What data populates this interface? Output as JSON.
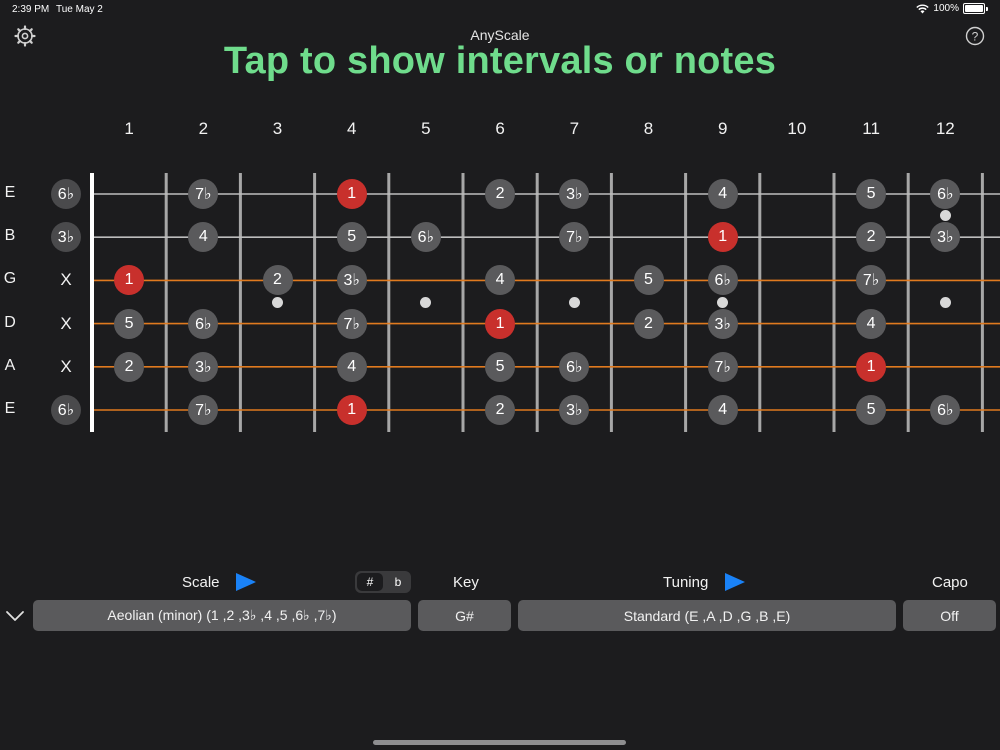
{
  "status": {
    "time": "2:39 PM",
    "date": "Tue May 2",
    "battery": "100%"
  },
  "app": {
    "title": "AnyScale",
    "headline": "Tap to show intervals or notes"
  },
  "icons": {
    "settings": "gear-icon",
    "help": "question-mark-icon",
    "collapse": "chevron-down-icon",
    "play": "play-icon"
  },
  "fret_numbers": [
    "1",
    "2",
    "3",
    "4",
    "5",
    "6",
    "7",
    "8",
    "9",
    "10",
    "11",
    "12"
  ],
  "strings": [
    {
      "name": "E",
      "open": "6♭",
      "notes": [
        {
          "fret": 2,
          "label": "7♭"
        },
        {
          "fret": 4,
          "label": "1",
          "root": true
        },
        {
          "fret": 6,
          "label": "2"
        },
        {
          "fret": 7,
          "label": "3♭"
        },
        {
          "fret": 9,
          "label": "4"
        },
        {
          "fret": 11,
          "label": "5"
        },
        {
          "fret": 12,
          "label": "6♭"
        }
      ]
    },
    {
      "name": "B",
      "open": "3♭",
      "notes": [
        {
          "fret": 2,
          "label": "4"
        },
        {
          "fret": 4,
          "label": "5"
        },
        {
          "fret": 5,
          "label": "6♭"
        },
        {
          "fret": 7,
          "label": "7♭"
        },
        {
          "fret": 9,
          "label": "1",
          "root": true
        },
        {
          "fret": 11,
          "label": "2"
        },
        {
          "fret": 12,
          "label": "3♭"
        }
      ]
    },
    {
      "name": "G",
      "open": "X",
      "notes": [
        {
          "fret": 1,
          "label": "1",
          "root": true
        },
        {
          "fret": 3,
          "label": "2"
        },
        {
          "fret": 4,
          "label": "3♭"
        },
        {
          "fret": 6,
          "label": "4"
        },
        {
          "fret": 8,
          "label": "5"
        },
        {
          "fret": 9,
          "label": "6♭"
        },
        {
          "fret": 11,
          "label": "7♭"
        }
      ]
    },
    {
      "name": "D",
      "open": "X",
      "notes": [
        {
          "fret": 1,
          "label": "5"
        },
        {
          "fret": 2,
          "label": "6♭"
        },
        {
          "fret": 4,
          "label": "7♭"
        },
        {
          "fret": 6,
          "label": "1",
          "root": true
        },
        {
          "fret": 8,
          "label": "2"
        },
        {
          "fret": 9,
          "label": "3♭"
        },
        {
          "fret": 11,
          "label": "4"
        }
      ]
    },
    {
      "name": "A",
      "open": "X",
      "notes": [
        {
          "fret": 1,
          "label": "2"
        },
        {
          "fret": 2,
          "label": "3♭"
        },
        {
          "fret": 4,
          "label": "4"
        },
        {
          "fret": 6,
          "label": "5"
        },
        {
          "fret": 7,
          "label": "6♭"
        },
        {
          "fret": 9,
          "label": "7♭"
        },
        {
          "fret": 11,
          "label": "1",
          "root": true
        }
      ]
    },
    {
      "name": "E",
      "open": "6♭",
      "notes": [
        {
          "fret": 2,
          "label": "7♭"
        },
        {
          "fret": 4,
          "label": "1",
          "root": true
        },
        {
          "fret": 6,
          "label": "2"
        },
        {
          "fret": 7,
          "label": "3♭"
        },
        {
          "fret": 9,
          "label": "4"
        },
        {
          "fret": 11,
          "label": "5"
        },
        {
          "fret": 12,
          "label": "6♭"
        }
      ]
    }
  ],
  "inlays": [
    3,
    5,
    7,
    9,
    12
  ],
  "colors": {
    "headline": "#6fdc8c",
    "root": "#c8302c",
    "note": "#5a5a5c",
    "wound_string": "#e07a1f",
    "plain_string": "#bdbdbd",
    "accent": "#1a82f7"
  },
  "controls": {
    "scale_label": "Scale",
    "sharp": "#",
    "flat": "b",
    "key_label": "Key",
    "tuning_label": "Tuning",
    "capo_label": "Capo",
    "scale_value": "Aeolian (minor) (1 ,2 ,3♭ ,4 ,5 ,6♭ ,7♭)",
    "key_value": "G#",
    "tuning_value": "Standard (E ,A ,D ,G ,B ,E)",
    "capo_value": "Off"
  }
}
